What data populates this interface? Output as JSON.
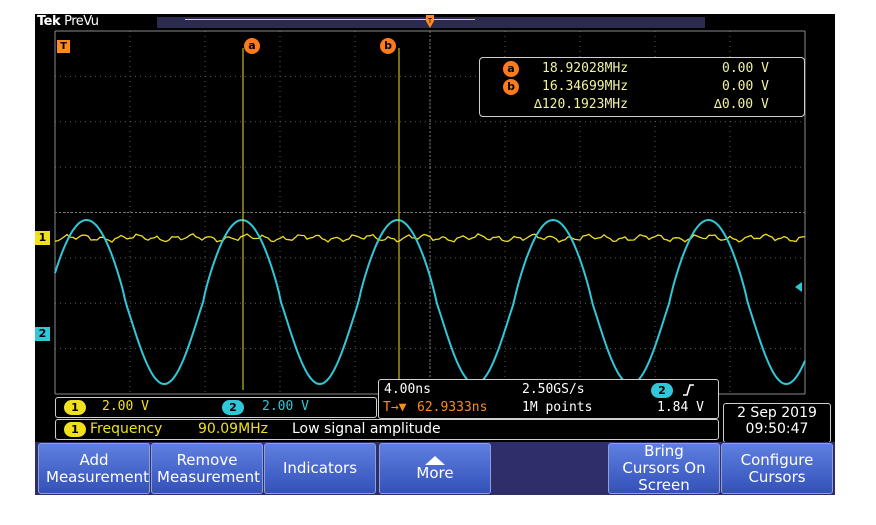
{
  "brand": {
    "name": "Tek",
    "mode": "PreVu"
  },
  "colors": {
    "ch1": "#f0e020",
    "ch2": "#30c8d8",
    "cursor": "#ff7a1a",
    "grid": "#6a6a6a",
    "button": "#4868d0"
  },
  "cursor_readout": {
    "a_label": "a",
    "a_freq": "18.92028MHz",
    "a_volt": "0.00 V",
    "b_label": "b",
    "b_freq": "16.34699MHz",
    "b_volt": "0.00 V",
    "delta_freq": "∆120.1923MHz",
    "delta_volt": "∆0.00 V"
  },
  "markers": {
    "trigger": "T",
    "cursor_a": "a",
    "cursor_b": "b",
    "ch1": "1",
    "ch2": "2"
  },
  "channels": {
    "ch1_num": "1",
    "ch1_scale": "2.00 V",
    "ch2_num": "2",
    "ch2_scale": "2.00 V"
  },
  "horizontal": {
    "time_div": "4.00ns",
    "sample_rate": "2.50GS/s",
    "trigger_src": "2",
    "trigger_slope_icon": "rising-edge-icon",
    "trigger_pos_icon": "T→▼",
    "trigger_pos": "62.9333ns",
    "record_len": "1M points",
    "trigger_level": "1.84 V"
  },
  "measurement": {
    "chan": "1",
    "name": "Frequency",
    "value": "90.09MHz",
    "status": "Low signal amplitude"
  },
  "datetime": {
    "date": "2 Sep  2019",
    "time": "09:50:47"
  },
  "buttons": {
    "add": "Add Measurement",
    "remove": "Remove Measurement",
    "indicators": "Indicators",
    "more": "More",
    "bring": "Bring Cursors On Screen",
    "configure": "Configure Cursors"
  }
}
